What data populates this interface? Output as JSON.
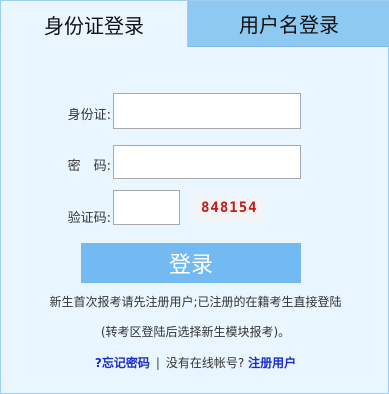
{
  "tabs": {
    "id_card": "身份证登录",
    "username": "用户名登录"
  },
  "form": {
    "id_label": "身份证:",
    "password_label": "密　码:",
    "captcha_label": "验证码:",
    "captcha_code": "848154",
    "login_button": "登录"
  },
  "notice": {
    "line1": "新生首次报考请先注册用户;已注册的在籍考生直接登陆",
    "line2": "(转考区登陆后选择新生模块报考)。"
  },
  "links": {
    "forgot_password": "?忘记密码",
    "separator": "|",
    "no_account": "没有在线帐号?",
    "register": "注册用户"
  },
  "colors": {
    "panel_background": "#eaf6ff",
    "inactive_tab": "#8ec9f2",
    "login_button": "#73b9f2",
    "captcha_text": "#c41a1a",
    "link": "#1a2ccf"
  }
}
